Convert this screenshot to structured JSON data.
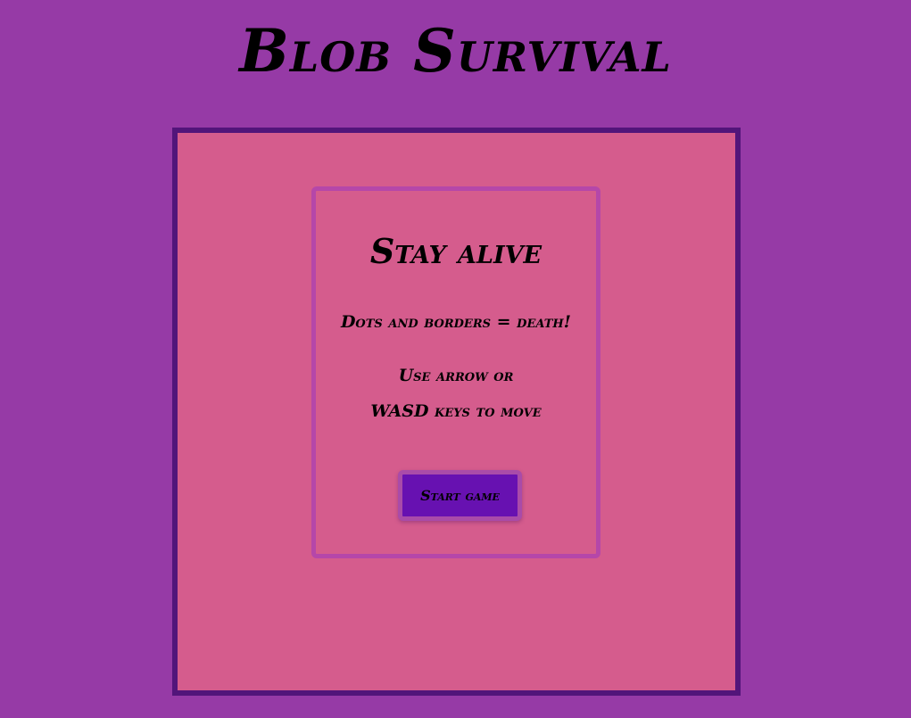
{
  "title": "Blob Survival",
  "menu": {
    "heading": "Stay alive",
    "rule_death": "Dots and borders = death!",
    "rule_keys_line1": "Use arrow or",
    "rule_keys_line2": "WASD keys to move",
    "start_label": "Start game"
  },
  "colors": {
    "background": "#963aa6",
    "arena_fill": "#d55c8d",
    "arena_border": "#52157a",
    "card_border": "#b547a9",
    "button_fill": "#6711b1",
    "button_border": "#a94ba9"
  }
}
